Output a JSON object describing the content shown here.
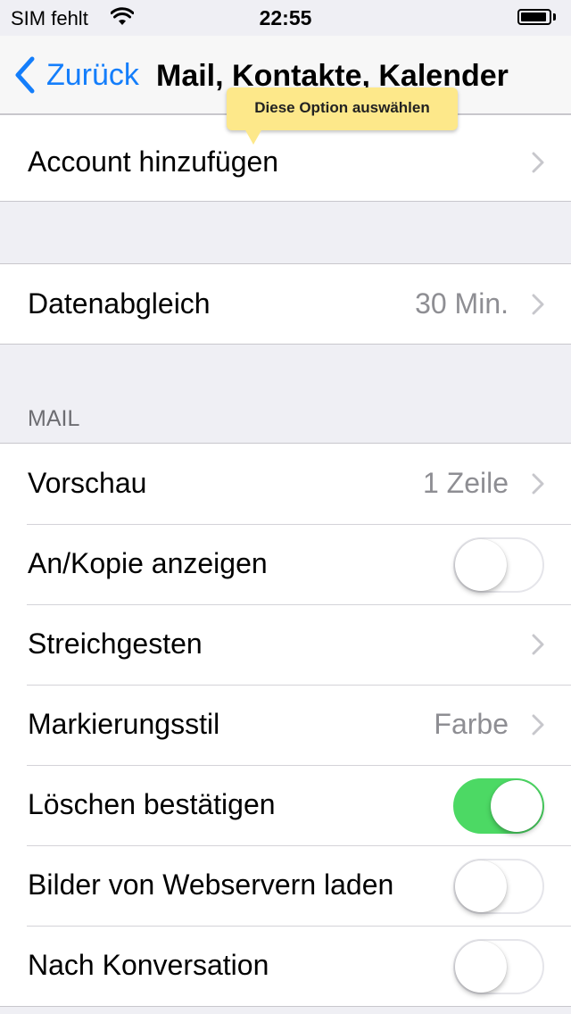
{
  "status_bar": {
    "carrier": "SIM fehlt",
    "time": "22:55",
    "icons": [
      "wifi-icon",
      "battery-icon"
    ]
  },
  "nav": {
    "back_label": "Zurück",
    "title": "Mail, Kontakte, Kalender"
  },
  "tooltip": {
    "text": "Diese Option auswählen",
    "color": "#fde88a"
  },
  "accounts": {
    "add_account": "Account hinzufügen"
  },
  "sync": {
    "label": "Datenabgleich",
    "value": "30 Min."
  },
  "mail_section": {
    "header": "MAIL",
    "preview": {
      "label": "Vorschau",
      "value": "1 Zeile"
    },
    "show_to_cc": {
      "label": "An/Kopie anzeigen",
      "on": false
    },
    "swipe_options": {
      "label": "Streichgesten"
    },
    "flag_style": {
      "label": "Markierungsstil",
      "value": "Farbe"
    },
    "ask_before_deleting": {
      "label": "Löschen bestätigen",
      "on": true
    },
    "load_remote_images": {
      "label": "Bilder von Webservern laden",
      "on": false
    },
    "organize_by_thread": {
      "label": "Nach Konversation",
      "on": false
    }
  },
  "colors": {
    "accent": "#147efb",
    "toggle_on": "#4cd964",
    "background": "#efeff4"
  }
}
